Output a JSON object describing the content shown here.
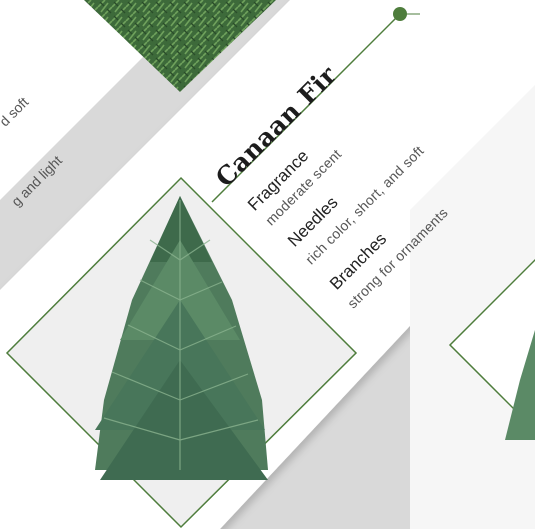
{
  "tree": {
    "name": "Canaan Fir",
    "specs": [
      {
        "label": "Fragrance",
        "desc": "moderate scent"
      },
      {
        "label": "Needles",
        "desc": "rich color, short, and soft"
      },
      {
        "label": "Branches",
        "desc": "strong for ornaments"
      }
    ]
  },
  "left_card": {
    "fragments": [
      "d soft",
      "g and light"
    ]
  },
  "colors": {
    "accent_green": "#4e7d3c",
    "card_bg": "#ffffff",
    "page_bg": "#d9d9d9"
  },
  "icons": [
    "accent-dot-icon"
  ]
}
